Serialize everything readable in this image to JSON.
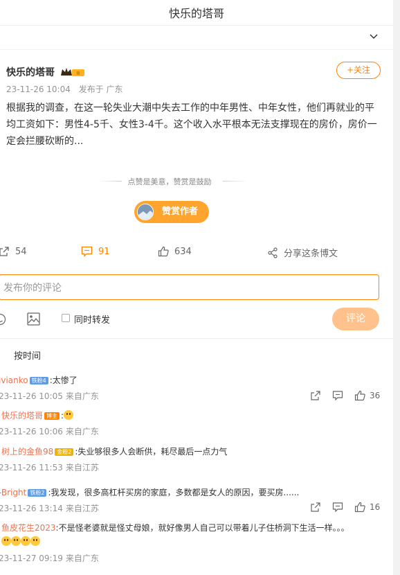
{
  "header": {
    "title": "快乐的塔哥"
  },
  "post": {
    "author": "快乐的塔哥",
    "follow_label": "+关注",
    "time": "23-11-26 10:04",
    "source": "发布于 广东",
    "text": "根据我的调查，在这一轮失业大潮中失去工作的中年男性、中年女性，他们再就业的平均工资如下：男性4-5千、女性3-4千。这个收入水平根本无法支撑现在的房价，房价一定会拦腰砍断的..."
  },
  "reward": {
    "hint": "点赞是美意，赞赏是鼓励",
    "button_label": "赞赏作者"
  },
  "actions": {
    "repost_count": "54",
    "comment_count": "91",
    "like_count": "634",
    "share_label": "分享这条博文"
  },
  "composer": {
    "placeholder": "发布你的评论",
    "also_repost_label": "同时转发",
    "submit_label": "评论"
  },
  "sort": {
    "label": "按时间"
  },
  "comments": [
    {
      "name": "ivianko",
      "badge": "铁粉4",
      "text": ":太惨了",
      "time": "23-11-26 10:05",
      "location": "来自广东",
      "likes": "36"
    },
    {
      "name": "快乐的塔哥",
      "badge": "博主",
      "text": ":",
      "time": "23-11-26 10:06",
      "location": "来自广东"
    },
    {
      "name": "树上的金鱼98",
      "badge": "金粉2",
      "text": ":失业够很多人会断供，耗尽最后一点力气",
      "time": "23-11-26 11:53",
      "location": "来自江苏"
    },
    {
      "name": "-Bright",
      "badge": "铁粉2",
      "text": ":我发现，很多高杠杆买房的家庭，多数都是女人的原因，要买房......",
      "time": "23-11-26 13:14",
      "location": "来自江苏",
      "likes": "16"
    },
    {
      "name": "鱼皮花生2023",
      "text": ":不是怪老婆就是怪丈母娘，就好像男人自己可以带着儿子住桥洞下生活一样。。。",
      "time": "23-11-27 09:19",
      "location": "来自广东"
    }
  ],
  "colors": {
    "accent": "#ff8200",
    "link": "#eb7350",
    "muted": "#939393"
  }
}
